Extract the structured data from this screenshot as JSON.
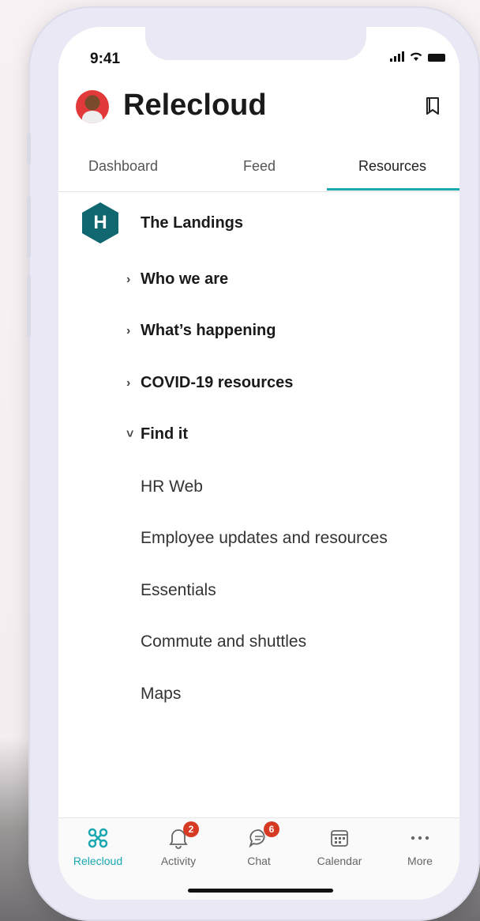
{
  "status_bar": {
    "time": "9:41"
  },
  "header": {
    "app_title": "Relecloud"
  },
  "tabs": [
    {
      "label": "Dashboard"
    },
    {
      "label": "Feed"
    },
    {
      "label": "Resources",
      "active": true
    }
  ],
  "site": {
    "icon_letter": "H",
    "name": "The Landings"
  },
  "nav_sections": [
    {
      "label": "Who we are",
      "expanded": false
    },
    {
      "label": "What’s happening",
      "expanded": false
    },
    {
      "label": "COVID-19 resources",
      "expanded": false
    },
    {
      "label": "Find it",
      "expanded": true
    }
  ],
  "find_it_links": [
    {
      "label": "HR Web"
    },
    {
      "label": "Employee updates and resources"
    },
    {
      "label": "Essentials"
    },
    {
      "label": "Commute and shuttles"
    },
    {
      "label": "Maps"
    }
  ],
  "bottom_nav": [
    {
      "label": "Relecloud",
      "icon": "relecloud-icon",
      "active": true
    },
    {
      "label": "Activity",
      "icon": "bell-icon",
      "badge": "2"
    },
    {
      "label": "Chat",
      "icon": "chat-icon",
      "badge": "6"
    },
    {
      "label": "Calendar",
      "icon": "calendar-icon"
    },
    {
      "label": "More",
      "icon": "more-icon"
    }
  ],
  "colors": {
    "accent": "#1aa8b0",
    "site_icon": "#11676f",
    "badge": "#d73a22"
  }
}
